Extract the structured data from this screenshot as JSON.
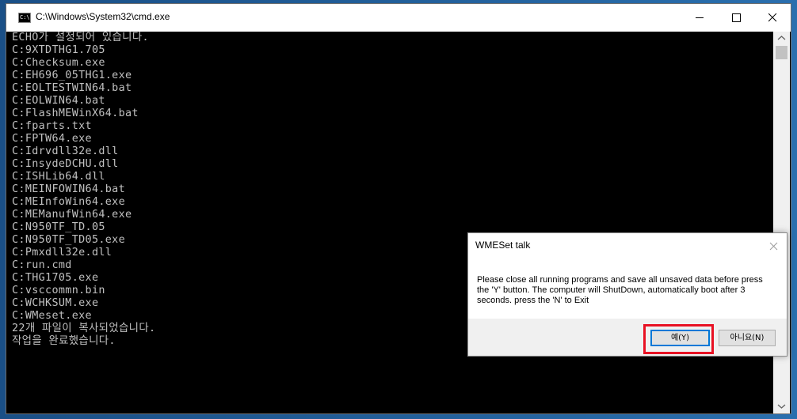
{
  "window": {
    "title": "C:\\Windows\\System32\\cmd.exe",
    "icon_label": "C:\\"
  },
  "console": {
    "lines": [
      "ECHO가 설정되어 있습니다.",
      "C:9XTDTHG1.705",
      "C:Checksum.exe",
      "C:EH696_05THG1.exe",
      "C:EOLTESTWIN64.bat",
      "C:EOLWIN64.bat",
      "C:FlashMEWinX64.bat",
      "C:fparts.txt",
      "C:FPTW64.exe",
      "C:Idrvdll32e.dll",
      "C:InsydeDCHU.dll",
      "C:ISHLib64.dll",
      "C:MEINFOWIN64.bat",
      "C:MEInfoWin64.exe",
      "C:MEManufWin64.exe",
      "C:N950TF_TD.05",
      "C:N950TF_TD05.exe",
      "C:Pmxdll32e.dll",
      "C:run.cmd",
      "C:THG1705.exe",
      "C:vsccommn.bin",
      "C:WCHKSUM.exe",
      "C:WMeset.exe",
      "22개 파일이 복사되었습니다.",
      "작업을 완료했습니다."
    ]
  },
  "dialog": {
    "title": "WMESet talk",
    "message": "Please close all running programs and save all unsaved data before press the 'Y' button. The computer will ShutDown, automatically boot after 3 seconds.  press the 'N' to Exit",
    "yes_label": "예(Y)",
    "no_label": "아니요(N)"
  },
  "icons": {
    "minimize": "minimize-icon",
    "maximize": "maximize-icon",
    "close": "close-icon",
    "dialog_close": "close-icon"
  },
  "colors": {
    "highlight": "#e81123",
    "console_text": "#c0c0c0",
    "focus_border": "#0078d7"
  }
}
